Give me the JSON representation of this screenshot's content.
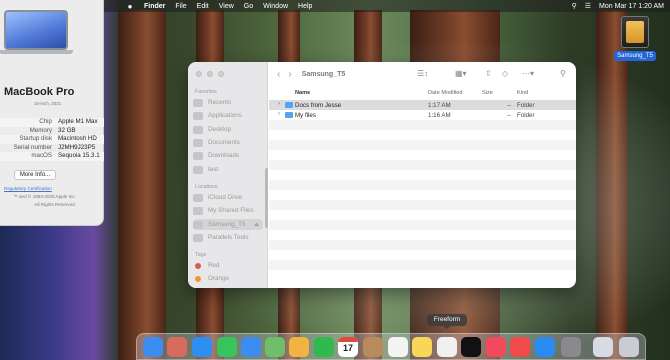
{
  "menubar": {
    "apple": "",
    "app_name": "Finder",
    "items": [
      "File",
      "Edit",
      "View",
      "Go",
      "Window",
      "Help"
    ],
    "datetime": "Mon Mar 17  1:20 AM"
  },
  "about": {
    "title": "MacBook Pro",
    "subtitle": "16-inch, 2021",
    "specs": [
      {
        "key": "Chip",
        "value": "Apple M1 Max"
      },
      {
        "key": "Memory",
        "value": "32 GB"
      },
      {
        "key": "Startup disk",
        "value": "Macintosh HD"
      },
      {
        "key": "Serial number",
        "value": "J2MH9J23P5"
      },
      {
        "key": "macOS",
        "value": "Sequoia 15.3.1"
      }
    ],
    "more_info": "More Info...",
    "regulatory": "Regulatory Certification",
    "copyright": "™ and © 1983-2025 Apple Inc.",
    "rights": "All Rights Reserved."
  },
  "desktop": {
    "disk_label": "Samsung_T5"
  },
  "finder": {
    "title": "Samsung_T5",
    "sidebar": {
      "sections": [
        {
          "label": "Favorites"
        },
        {
          "label": "Locations"
        },
        {
          "label": "Tags"
        }
      ],
      "favorites": [
        "Recents",
        "Applications",
        "Desktop",
        "Documents",
        "Downloads",
        "test"
      ],
      "locations": [
        "iCloud Drive",
        "My Shared Files",
        "Samsung_T5",
        "Parallels Tools"
      ],
      "tags": [
        {
          "label": "Red",
          "color": "#e0584e"
        },
        {
          "label": "Orange",
          "color": "#f0962e"
        }
      ]
    },
    "columns": {
      "name": "Name",
      "modified": "Date Modified",
      "size": "Size",
      "kind": "Kind"
    },
    "files": [
      {
        "name": "Docs from Jesse",
        "modified": "1:17 AM",
        "size": "--",
        "kind": "Folder"
      },
      {
        "name": "My files",
        "modified": "1:16 AM",
        "size": "--",
        "kind": "Folder"
      }
    ]
  },
  "dock": {
    "tooltip": "Freeform",
    "calendar_month": "MAR",
    "calendar_day": "17",
    "apps": [
      {
        "name": "finder",
        "color": "#3b8ef0"
      },
      {
        "name": "launchpad",
        "color": "#d96b5e"
      },
      {
        "name": "safari",
        "color": "#2f8ff0"
      },
      {
        "name": "messages",
        "color": "#38c45a"
      },
      {
        "name": "mail",
        "color": "#3c8df2"
      },
      {
        "name": "maps",
        "color": "#6fbf6a"
      },
      {
        "name": "photos",
        "color": "#f2b440"
      },
      {
        "name": "facetime",
        "color": "#2fb94f"
      },
      {
        "name": "calendar",
        "color": "#ffffff"
      },
      {
        "name": "contacts",
        "color": "#b98a5a"
      },
      {
        "name": "reminders",
        "color": "#f4f4f4"
      },
      {
        "name": "notes",
        "color": "#f7d65a"
      },
      {
        "name": "freeform",
        "color": "#f0f0f0"
      },
      {
        "name": "apple-tv",
        "color": "#111111"
      },
      {
        "name": "music",
        "color": "#f2495c"
      },
      {
        "name": "news",
        "color": "#f04a4a"
      },
      {
        "name": "app-store",
        "color": "#2a8cf0"
      },
      {
        "name": "system-settings",
        "color": "#8a8a8e"
      },
      {
        "name": "preview",
        "color": "#d7dbe3"
      },
      {
        "name": "trash",
        "color": "#c9ccd2"
      }
    ]
  }
}
